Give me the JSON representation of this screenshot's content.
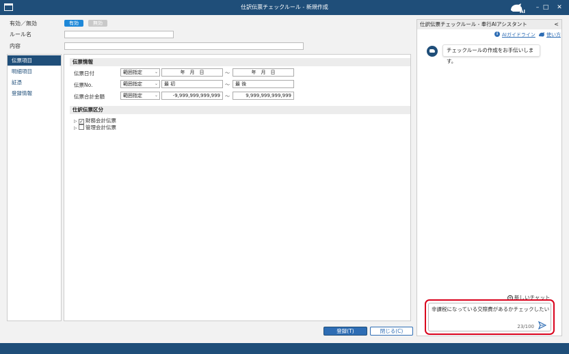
{
  "window": {
    "title": "仕訳伝票チェックルール - 新規作成",
    "logo_text": "AI",
    "minimize": "–",
    "maximize": "□",
    "close": "✕"
  },
  "form": {
    "status_label": "有効／無効",
    "toggle_on": "有効",
    "toggle_off": "無効",
    "rule_name_label": "ルール名",
    "content_label": "内容"
  },
  "sidebar": {
    "items": [
      {
        "label": "伝票項目",
        "active": true
      },
      {
        "label": "明細項目",
        "active": false
      },
      {
        "label": "証憑",
        "active": false
      },
      {
        "label": "登録情報",
        "active": false
      }
    ]
  },
  "voucher_info": {
    "section_title": "伝票情報",
    "rows": [
      {
        "label": "伝票日付",
        "mode": "範囲指定",
        "from": "年　月　日",
        "to": "年　月　日"
      },
      {
        "label": "伝票No.",
        "mode": "範囲指定",
        "from": "最 初",
        "to": "最 後"
      },
      {
        "label": "伝票合計金額",
        "mode": "範囲指定",
        "from": "-9,999,999,999,999",
        "to": "9,999,999,999,999"
      }
    ],
    "tilde": "～"
  },
  "voucher_type": {
    "section_title": "仕訳伝票区分",
    "items": [
      {
        "label": "財務会計伝票",
        "checked": true
      },
      {
        "label": "管理会計伝票",
        "checked": false
      }
    ]
  },
  "footer": {
    "register_label": "登録(T)",
    "close_label": "閉じる(C)"
  },
  "assistant": {
    "title": "仕訳伝票チェックルール - 奉行AIアシスタント",
    "collapse": "<",
    "guideline_link": "AIガイドライン",
    "howto_link": "使い方",
    "message": "チェックルールの作成をお手伝いします。",
    "new_chat": "新しいチャット",
    "input_value": "非課税になっている交際費があるかチェックしたい",
    "char_count": "23/100"
  },
  "colors": {
    "title_bar": "#1f4e79",
    "accent": "#2e6db4",
    "toggle_on": "#1e88d8",
    "highlight": "#d9001b"
  }
}
